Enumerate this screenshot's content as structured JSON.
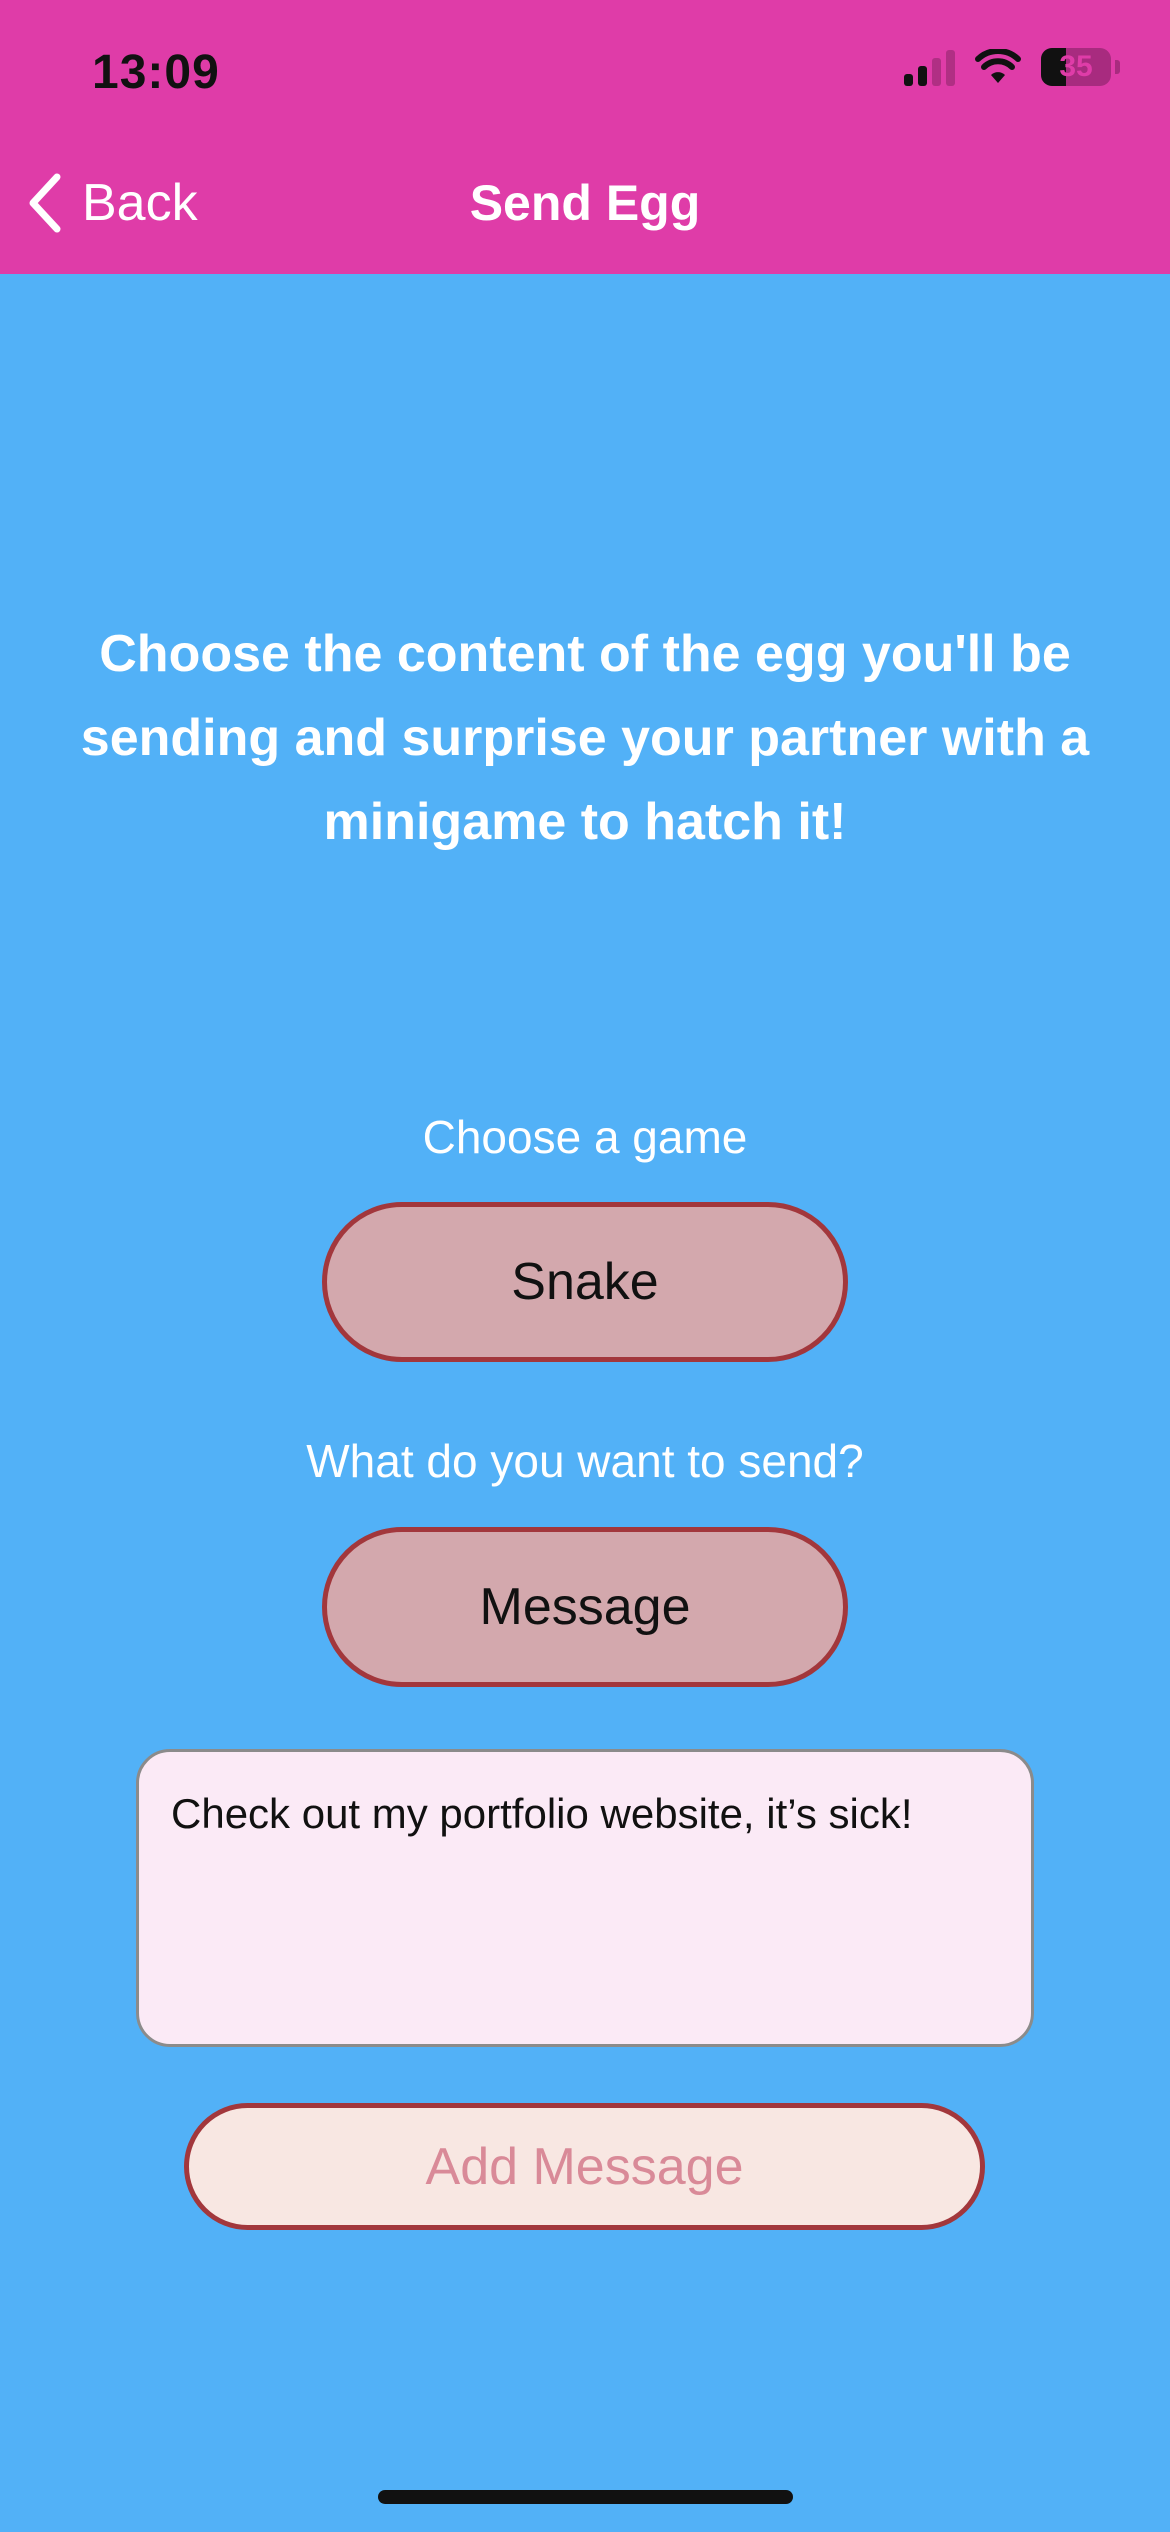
{
  "status_bar": {
    "time": "13:09",
    "battery_level": "35",
    "icons": [
      "cellular-signal-icon",
      "wifi-icon",
      "battery-icon"
    ]
  },
  "nav": {
    "back_label": "Back",
    "title": "Send Egg",
    "back_icon": "chevron-left-icon"
  },
  "intro_text": "Choose the content of the egg you'll be sending and surprise your partner with a minigame to hatch it!",
  "game": {
    "label": "Choose a game",
    "selected": "Snake"
  },
  "send_type": {
    "label": "What do you want to send?",
    "selected": "Message"
  },
  "message_input": {
    "value": "Check out my portfolio website, it’s sick!"
  },
  "add_button": {
    "label": "Add Message"
  },
  "colors": {
    "header_bg": "#df3ca8",
    "screen_bg": "#52b1f7",
    "pill_bg": "#d3a8ad",
    "pill_border": "#a2373c",
    "input_bg": "#fbeaf6",
    "add_button_bg": "#f8e7e2",
    "add_button_text": "#d98a98"
  }
}
